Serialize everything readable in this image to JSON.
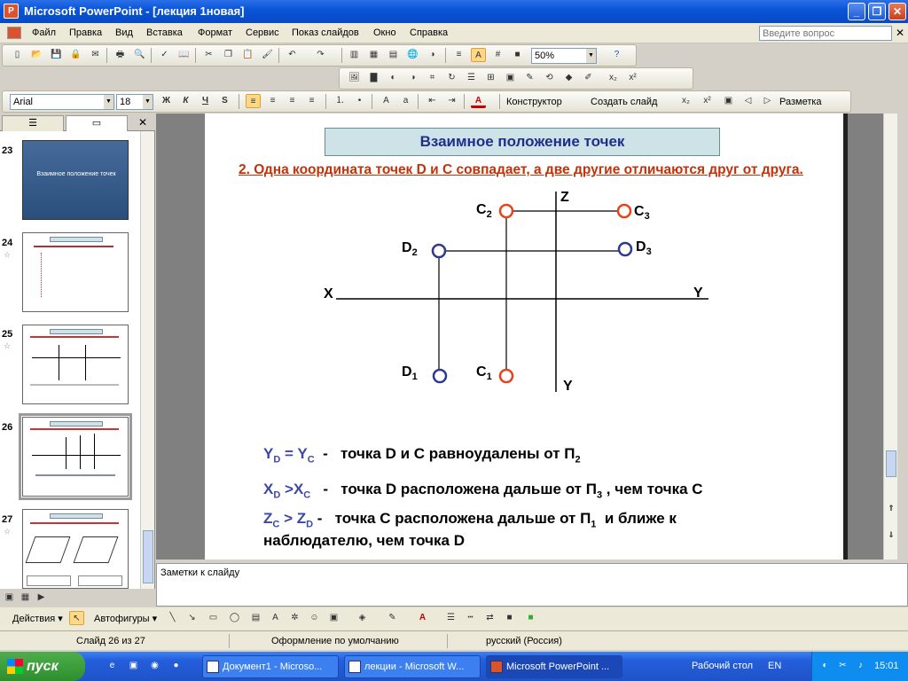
{
  "window": {
    "title": "Microsoft PowerPoint - [лекция 1новая]"
  },
  "menu": {
    "items": [
      "Файл",
      "Правка",
      "Вид",
      "Вставка",
      "Формат",
      "Сервис",
      "Показ слайдов",
      "Окно",
      "Справка"
    ],
    "help_placeholder": "Введите вопрос"
  },
  "toolbar": {
    "zoom": "50%",
    "font": "Arial",
    "size": "18",
    "designer": "Конструктор",
    "new_slide": "Создать слайд",
    "layout": "Разметка",
    "bold": "Ж",
    "italic": "К",
    "underline": "Ч",
    "shadow": "S"
  },
  "thumbnails": {
    "items": [
      {
        "num": "23",
        "title": "Взаимное положение точек"
      },
      {
        "num": "24"
      },
      {
        "num": "25"
      },
      {
        "num": "26"
      },
      {
        "num": "27"
      }
    ]
  },
  "slide": {
    "title": "Взаимное положение точек",
    "heading": "2. Одна координата точек D и С совпадает, а две другие отличаются друг от друга.",
    "axis": {
      "z": "Z",
      "x": "X",
      "y_right": "Y",
      "y_down": "Y"
    },
    "points": {
      "c2": {
        "base": "C",
        "sub": "2"
      },
      "c3": {
        "base": "C",
        "sub": "3"
      },
      "d2": {
        "base": "D",
        "sub": "2"
      },
      "d3": {
        "base": "D",
        "sub": "3"
      },
      "d1": {
        "base": "D",
        "sub": "1"
      },
      "c1": {
        "base": "C",
        "sub": "1"
      }
    },
    "statements": [
      {
        "lhs_a": "Y",
        "lhs_a_sub": "D",
        "op": " = ",
        "lhs_b": "Y",
        "lhs_b_sub": "C",
        "text": "  -   точка D и С равноудалены от П",
        "text_sub": "2",
        "tail": ""
      },
      {
        "lhs_a": "X",
        "lhs_a_sub": "D",
        "op": " >",
        "lhs_b": "X",
        "lhs_b_sub": "C",
        "text": "   -   точка D расположена дальше от П",
        "text_sub": "3",
        "tail": " , чем точка С"
      },
      {
        "lhs_a": "Z",
        "lhs_a_sub": "C",
        "op": " > ",
        "lhs_b": "Z",
        "lhs_b_sub": "D",
        "text": " -   точка С расположена дальше от П",
        "text_sub": "1",
        "tail": "  и ближе к"
      }
    ],
    "statement_line4": "наблюдателю, чем точка D"
  },
  "notes": {
    "placeholder": "Заметки к слайду"
  },
  "drawing": {
    "actions": "Действия",
    "autoshapes": "Автофигуры"
  },
  "status": {
    "slide": "Слайд 26 из 27",
    "design": "Оформление по умолчанию",
    "lang": "русский (Россия)"
  },
  "taskbar": {
    "start": "пуск",
    "tasks": [
      "Документ1 - Microso...",
      "лекции - Microsoft W...",
      "Microsoft PowerPoint ..."
    ],
    "desktop": "Рабочий стол",
    "lang": "EN",
    "clock": "15:01"
  },
  "colors": {
    "point_c": "#e8421c",
    "point_d": "#2e3a8c",
    "title_fill": "#cde3e8",
    "heading": "#c0340c"
  }
}
